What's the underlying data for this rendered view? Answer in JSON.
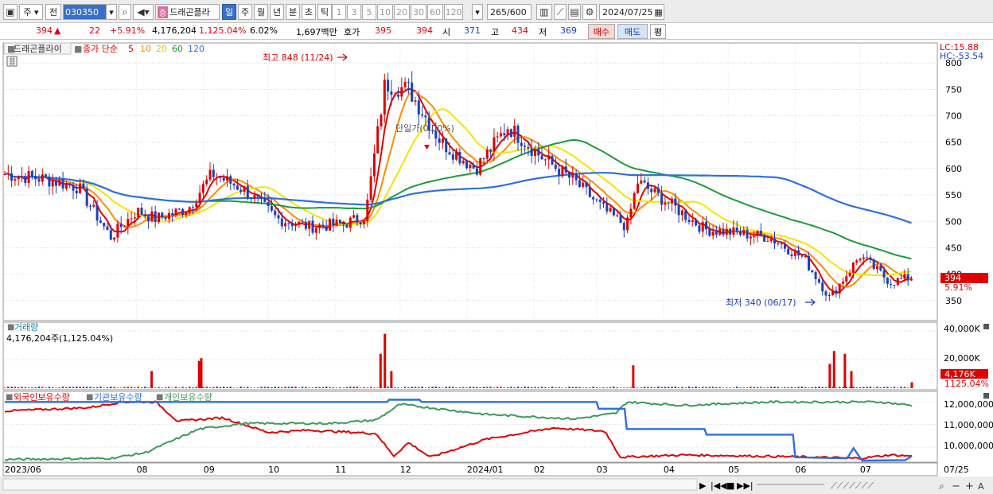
{
  "toolbar": {
    "market_label": "주",
    "prev_label": "전",
    "stock_code": "030350",
    "stock_name": "드래곤플라",
    "period_tabs": [
      {
        "label": "일",
        "active": true
      },
      {
        "label": "주",
        "active": false
      },
      {
        "label": "월",
        "active": false
      },
      {
        "label": "년",
        "active": false
      },
      {
        "label": "분",
        "active": false
      },
      {
        "label": "초",
        "active": false
      },
      {
        "label": "틱",
        "active": false
      }
    ],
    "interval_buttons": [
      "1",
      "3",
      "5",
      "10",
      "20",
      "30",
      "60",
      "120"
    ],
    "data_count": "265",
    "data_total": "/600",
    "date": "2024/07/25"
  },
  "quote": {
    "price": "394",
    "change_arrow": "▲",
    "change": "22",
    "change_pct": "+5.91%",
    "volume": "4,176,204",
    "volume_ratio": "1,125.04%",
    "turnover": "6.02%",
    "amount": "1,697백만",
    "hoga_label": "호가",
    "ask": "395",
    "bid": "394",
    "open_label": "시",
    "open": "371",
    "high_label": "고",
    "high": "434",
    "low_label": "저",
    "low": "369",
    "buy_label": "매수",
    "sell_label": "매도",
    "eval_label": "평"
  },
  "chart_data": [
    {
      "type": "candlestick",
      "name_label": "드래곤플라이",
      "ma_label": "종가 단순",
      "moving_averages": [
        {
          "period": "5",
          "color": "#e00000"
        },
        {
          "period": "10",
          "color": "#ff8c00"
        },
        {
          "period": "20",
          "color": "#f5e400"
        },
        {
          "period": "60",
          "color": "#1f9a3a"
        },
        {
          "period": "120",
          "color": "#2e6fe0"
        }
      ],
      "lc_label": "LC:15.88",
      "hc_label": "HC:-53.54",
      "y_ticks": [
        350,
        400,
        450,
        500,
        550,
        600,
        650,
        700,
        750,
        800
      ],
      "y_tick_labels": [
        "350",
        "400",
        "450",
        "500",
        "550",
        "600",
        "650",
        "700",
        "750",
        "800"
      ],
      "ylim": [
        315,
        835
      ],
      "current_price": "394",
      "current_change": "5.91%",
      "annotations": {
        "high": "최고 848 (11/24)",
        "low": "최저 340 (06/17)",
        "event": "단일가(0.00%)"
      },
      "x_labels": [
        "2023/06",
        "08",
        "09",
        "10",
        "11",
        "12",
        "2024/01",
        "02",
        "03",
        "04",
        "05",
        "06",
        "07"
      ],
      "x_label_right": "07/25",
      "close_series": [
        {
          "x": "2023/06/01",
          "close": 590
        },
        {
          "x": "2023/06/20",
          "close": 580
        },
        {
          "x": "2023/07/05",
          "close": 565
        },
        {
          "x": "2023/07/20",
          "close": 470
        },
        {
          "x": "2023/08/01",
          "close": 520
        },
        {
          "x": "2023/08/10",
          "close": 505
        },
        {
          "x": "2023/08/25",
          "close": 525
        },
        {
          "x": "2023/09/05",
          "close": 590
        },
        {
          "x": "2023/09/20",
          "close": 560
        },
        {
          "x": "2023/10/05",
          "close": 505
        },
        {
          "x": "2023/10/20",
          "close": 490
        },
        {
          "x": "2023/11/05",
          "close": 495
        },
        {
          "x": "2023/11/15",
          "close": 510
        },
        {
          "x": "2023/11/24",
          "close": 760
        },
        {
          "x": "2023/12/05",
          "close": 750
        },
        {
          "x": "2023/12/20",
          "close": 650
        },
        {
          "x": "2024/01/05",
          "close": 600
        },
        {
          "x": "2024/01/20",
          "close": 680
        },
        {
          "x": "2024/02/05",
          "close": 620
        },
        {
          "x": "2024/02/20",
          "close": 575
        },
        {
          "x": "2024/03/05",
          "close": 520
        },
        {
          "x": "2024/03/15",
          "close": 490
        },
        {
          "x": "2024/03/20",
          "close": 575
        },
        {
          "x": "2024/04/05",
          "close": 530
        },
        {
          "x": "2024/04/20",
          "close": 485
        },
        {
          "x": "2024/05/05",
          "close": 478
        },
        {
          "x": "2024/05/20",
          "close": 470
        },
        {
          "x": "2024/06/05",
          "close": 430
        },
        {
          "x": "2024/06/17",
          "close": 355
        },
        {
          "x": "2024/07/01",
          "close": 435
        },
        {
          "x": "2024/07/15",
          "close": 385
        },
        {
          "x": "2024/07/25",
          "close": 394
        }
      ]
    },
    {
      "type": "bar",
      "title": "거래량",
      "summary": "4,176,204주(1,125.04%)",
      "y_tick_labels": [
        "40,000K",
        "20,000K"
      ],
      "ylim": [
        0,
        45000
      ],
      "current_label": "4,176K",
      "current_pct": "1125.04%",
      "spikes": [
        {
          "x": "2023/08/08",
          "value": 12000
        },
        {
          "x": "2023/08/30",
          "value": 19000
        },
        {
          "x": "2023/08/31",
          "value": 21000
        },
        {
          "x": "2023/11/22",
          "value": 24000
        },
        {
          "x": "2023/11/24",
          "value": 38000
        },
        {
          "x": "2023/11/27",
          "value": 12000
        },
        {
          "x": "2024/03/18",
          "value": 16000
        },
        {
          "x": "2024/06/17",
          "value": 17000
        },
        {
          "x": "2024/06/19",
          "value": 26000
        },
        {
          "x": "2024/06/24",
          "value": 24000
        },
        {
          "x": "2024/06/27",
          "value": 12000
        },
        {
          "x": "2024/07/25",
          "value": 4176
        }
      ]
    },
    {
      "type": "line",
      "series": [
        {
          "name": "외국인보유수량",
          "color": "#e00000"
        },
        {
          "name": "기관보유수량",
          "color": "#2e6fe0"
        },
        {
          "name": "개인보유수량",
          "color": "#3b9a5b"
        }
      ],
      "y_tick_labels": [
        "12,000,000",
        "11,000,000",
        "10,000,000"
      ],
      "ylim": [
        9400000,
        12400000
      ]
    }
  ]
}
